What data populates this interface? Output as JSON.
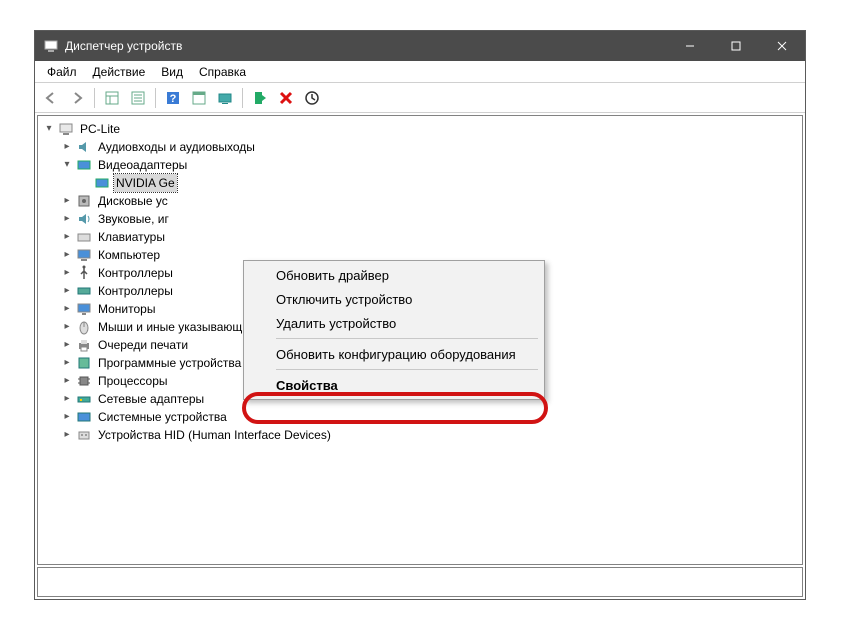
{
  "window": {
    "title": "Диспетчер устройств"
  },
  "menu": {
    "file": "Файл",
    "action": "Действие",
    "view": "Вид",
    "help": "Справка"
  },
  "root": {
    "name": "PC-Lite"
  },
  "tree": {
    "audio": "Аудиовходы и аудиовыходы",
    "video": "Видеоадаптеры",
    "nvidia": "NVIDIA Ge",
    "disk": "Дисковые ус",
    "sound": "Звуковые, иг",
    "keyboard": "Клавиатуры",
    "computer": "Компьютер",
    "ctrl1": "Контроллеры",
    "ctrl2": "Контроллеры",
    "monitor": "Мониторы",
    "mouse": "Мыши и иные указывающие устройства",
    "printq": "Очереди печати",
    "softdev": "Программные устройства",
    "cpu": "Процессоры",
    "net": "Сетевые адаптеры",
    "system": "Системные устройства",
    "hid": "Устройства HID (Human Interface Devices)"
  },
  "context": {
    "update": "Обновить драйвер",
    "disable": "Отключить устройство",
    "uninstall": "Удалить устройство",
    "scan": "Обновить конфигурацию оборудования",
    "properties": "Свойства"
  }
}
